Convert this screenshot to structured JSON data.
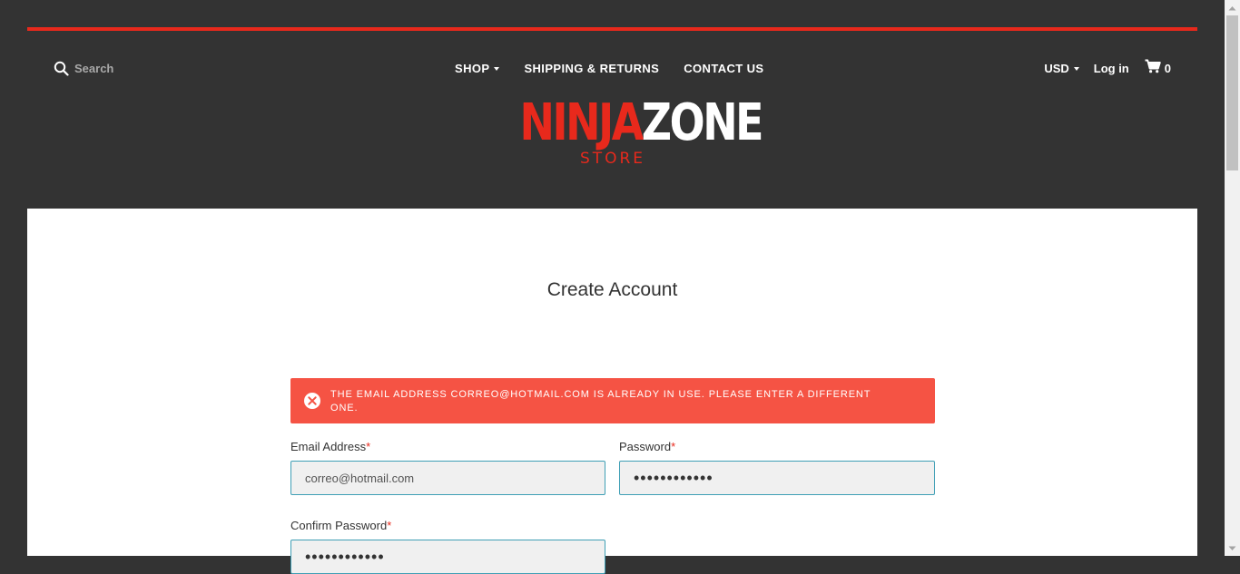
{
  "header": {
    "search_placeholder": "Search",
    "nav": [
      {
        "label": "SHOP",
        "has_dropdown": true
      },
      {
        "label": "SHIPPING & RETURNS",
        "has_dropdown": false
      },
      {
        "label": "CONTACT US",
        "has_dropdown": false
      }
    ],
    "currency": "USD",
    "login_label": "Log in",
    "cart_count": "0",
    "logo": {
      "part1": "NINJA",
      "part2": "ZONE",
      "sub": "STORE"
    }
  },
  "main": {
    "title": "Create Account",
    "error_message": "The email address correo@hotmail.com is already in use. Please enter a different one.",
    "fields": {
      "email": {
        "label": "Email Address",
        "required_mark": "*",
        "value": "correo@hotmail.com"
      },
      "password": {
        "label": "Password",
        "required_mark": "*",
        "value": "••••••••••••"
      },
      "confirm_password": {
        "label": "Confirm Password",
        "required_mark": "*",
        "value": "••••••••••••"
      }
    }
  },
  "colors": {
    "accent_red": "#e8291c",
    "header_bg": "#333333",
    "error_bg": "#f55344",
    "input_border": "#3f9fb5"
  },
  "icons": [
    "search-icon",
    "cart-icon",
    "error-icon",
    "chevron-down-icon"
  ]
}
